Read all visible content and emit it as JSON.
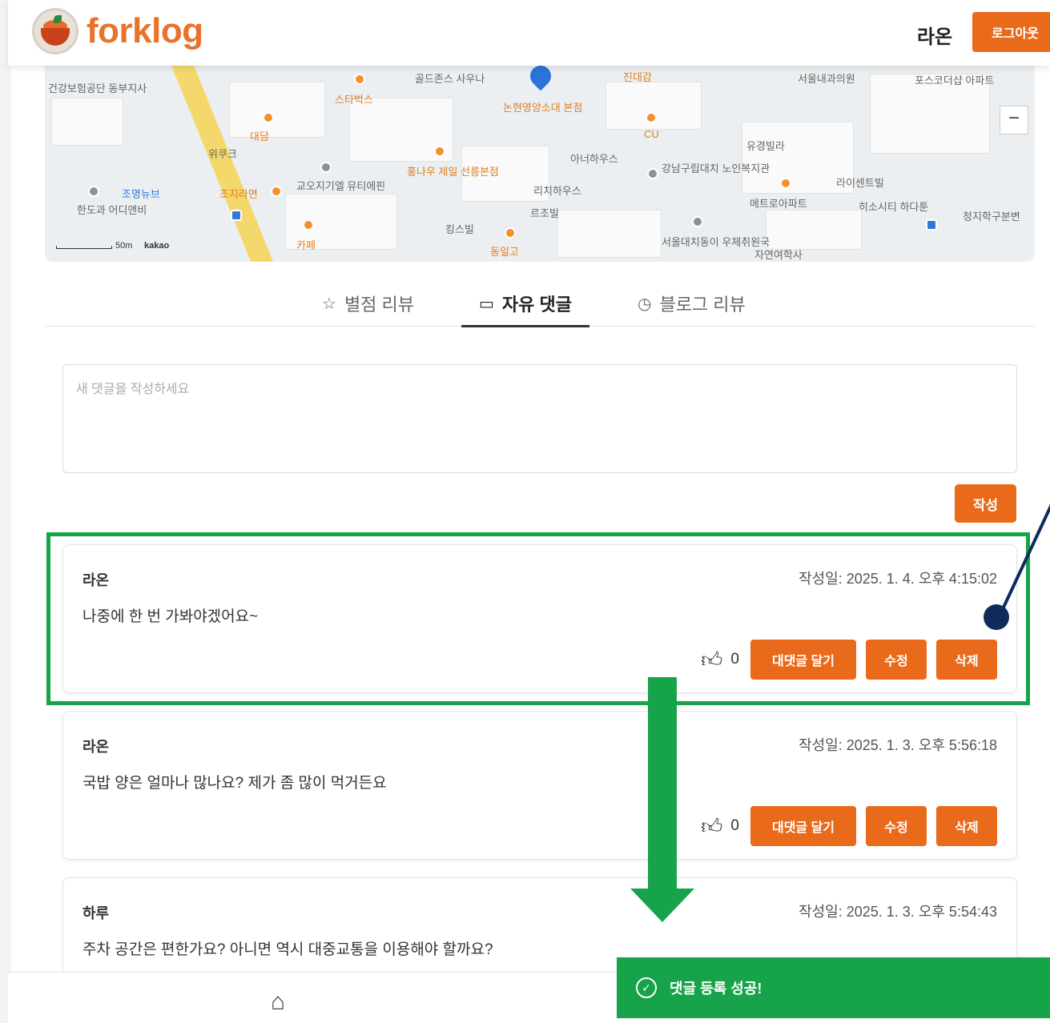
{
  "header": {
    "logo_text": "forklog",
    "username": "라온",
    "logout_label": "로그아웃"
  },
  "map": {
    "labels": [
      "건강보험공단 동부지사",
      "스타벅스",
      "골드존스 사우나",
      "논현영양소대 본점",
      "진대감",
      "서울내과의원",
      "포스코더샵 아파트",
      "대담",
      "위쿠크",
      "CU",
      "유경빌라",
      "아너하우스",
      "강남구립대치 노인복지관",
      "홍나우 제일 선릉본점",
      "교오지기엘 뮤티에핀",
      "조지라면",
      "한도과 어디앤비",
      "리치하우스",
      "르조빌",
      "킹스빌",
      "라이센트빌",
      "메트로아파트",
      "히소시티 하다툰",
      "청지학구분변",
      "카페",
      "동일고",
      "서울대치동이 우체취원국",
      "자연여학사",
      "조명뉴브"
    ],
    "attribution": "kakao",
    "scale": "50m"
  },
  "tabs": [
    {
      "label": "별점 리뷰",
      "icon": "star-icon"
    },
    {
      "label": "자유 댓글",
      "icon": "chat-icon"
    },
    {
      "label": "블로그 리뷰",
      "icon": "blog-icon"
    }
  ],
  "comment_form": {
    "placeholder": "새 댓글을 작성하세요",
    "submit_label": "작성"
  },
  "comments": [
    {
      "author": "라온",
      "date": "작성일: 2025. 1. 4. 오후 4:15:02",
      "text": "나중에 한 번 가봐야겠어요~",
      "likes": "0",
      "reply_label": "대댓글 달기",
      "edit_label": "수정",
      "delete_label": "삭제"
    },
    {
      "author": "라온",
      "date": "작성일: 2025. 1. 3. 오후 5:56:18",
      "text": "국밥 양은 얼마나 많나요? 제가 좀 많이 먹거든요",
      "likes": "0",
      "reply_label": "대댓글 달기",
      "edit_label": "수정",
      "delete_label": "삭제"
    },
    {
      "author": "하루",
      "date": "작성일: 2025. 1. 3. 오후 5:54:43",
      "text": "주차 공간은 편한가요? 아니면 역시 대중교통을 이용해야 할까요?"
    }
  ],
  "toast": {
    "message": "댓글 등록 성공!"
  },
  "colors": {
    "accent": "#ea6a1c",
    "highlight": "#16a34a",
    "pointer": "#0f2a5c"
  }
}
